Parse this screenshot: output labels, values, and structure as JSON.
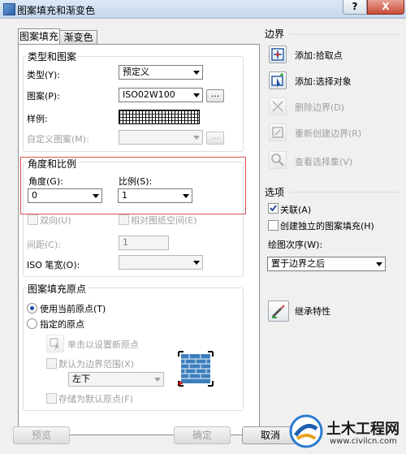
{
  "window": {
    "title": "图案填充和渐变色",
    "help_glyph": "?",
    "close_glyph": "X"
  },
  "tabs": [
    {
      "label": "图案填充"
    },
    {
      "label": "渐变色"
    }
  ],
  "type_pattern": {
    "group_label": "类型和图案",
    "type_label": "类型(Y):",
    "type_value": "预定义",
    "pattern_label": "图案(P):",
    "pattern_value": "ISO02W100",
    "pattern_dots": "...",
    "swatch_label": "样例:",
    "custom_label": "自定义图案(M):",
    "custom_value": "",
    "custom_dots": "..."
  },
  "angle_scale": {
    "group_label": "角度和比例",
    "angle_label": "角度(G):",
    "angle_value": "0",
    "scale_label": "比例(S):",
    "scale_value": "1",
    "double_label": "双向(U)",
    "relative_label": "相对图纸空间(E)",
    "spacing_label": "间距(C):",
    "spacing_value": "1",
    "iso_pen_label": "ISO 笔宽(O):",
    "iso_pen_value": ""
  },
  "origin": {
    "group_label": "图案填充原点",
    "use_current": "使用当前原点(T)",
    "specified": "指定的原点",
    "click_set": "单击以设置新原点",
    "default_extent": "默认为边界范围(X)",
    "position_value": "左下",
    "store_default": "存储为默认原点(F)"
  },
  "boundaries": {
    "group_label": "边界",
    "add_pick": "添加:拾取点",
    "add_select": "添加:选择对象",
    "remove": "删除边界(D)",
    "recreate": "重新创建边界(R)",
    "view_selection": "查看选择集(V)"
  },
  "options": {
    "group_label": "选项",
    "associative": "关联(A)",
    "create_separate": "创建独立的图案填充(H)",
    "draw_order_label": "绘图次序(W):",
    "draw_order_value": "置于边界之后"
  },
  "inherit": {
    "label": "继承特性"
  },
  "footer": {
    "preview": "预览",
    "ok": "确定",
    "cancel": "取消"
  },
  "watermark": {
    "name": "土木工程网",
    "url": "www.civilcn.com"
  }
}
